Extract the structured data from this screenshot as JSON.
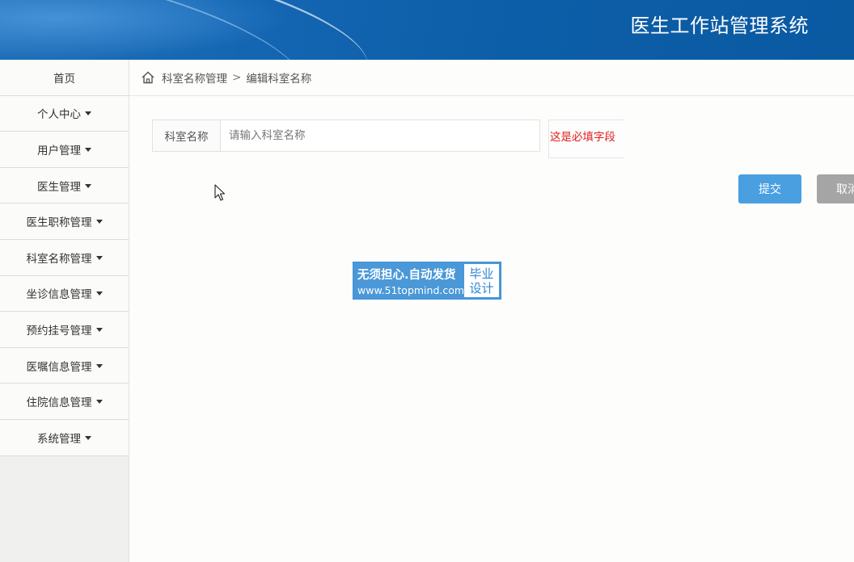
{
  "header": {
    "title": "医生工作站管理系统"
  },
  "sidebar": {
    "items": [
      {
        "label": "首页",
        "has_caret": false
      },
      {
        "label": "个人中心",
        "has_caret": true
      },
      {
        "label": "用户管理",
        "has_caret": true
      },
      {
        "label": "医生管理",
        "has_caret": true
      },
      {
        "label": "医生职称管理",
        "has_caret": true
      },
      {
        "label": "科室名称管理",
        "has_caret": true
      },
      {
        "label": "坐诊信息管理",
        "has_caret": true
      },
      {
        "label": "预约挂号管理",
        "has_caret": true
      },
      {
        "label": "医嘱信息管理",
        "has_caret": true
      },
      {
        "label": "住院信息管理",
        "has_caret": true
      },
      {
        "label": "系统管理",
        "has_caret": true
      }
    ]
  },
  "breadcrumb": {
    "icon": "home-icon",
    "parent": "科室名称管理",
    "separator": ">",
    "current": "编辑科室名称"
  },
  "form": {
    "field_label": "科室名称",
    "field_value": "",
    "field_placeholder": "请输入科室名称",
    "required_hint": "这是必填字段"
  },
  "buttons": {
    "submit_label": "提交",
    "cancel_label": "取消"
  },
  "watermark": {
    "line1": "无须担心.自动发货",
    "line2": "www.51topmind.com",
    "badge_line1": "毕业",
    "badge_line2": "设计"
  },
  "colors": {
    "header_blue": "#0d5ea8",
    "submit_blue": "#4a9fe0",
    "cancel_gray": "#a5a5a5",
    "required_red": "#e02020"
  }
}
